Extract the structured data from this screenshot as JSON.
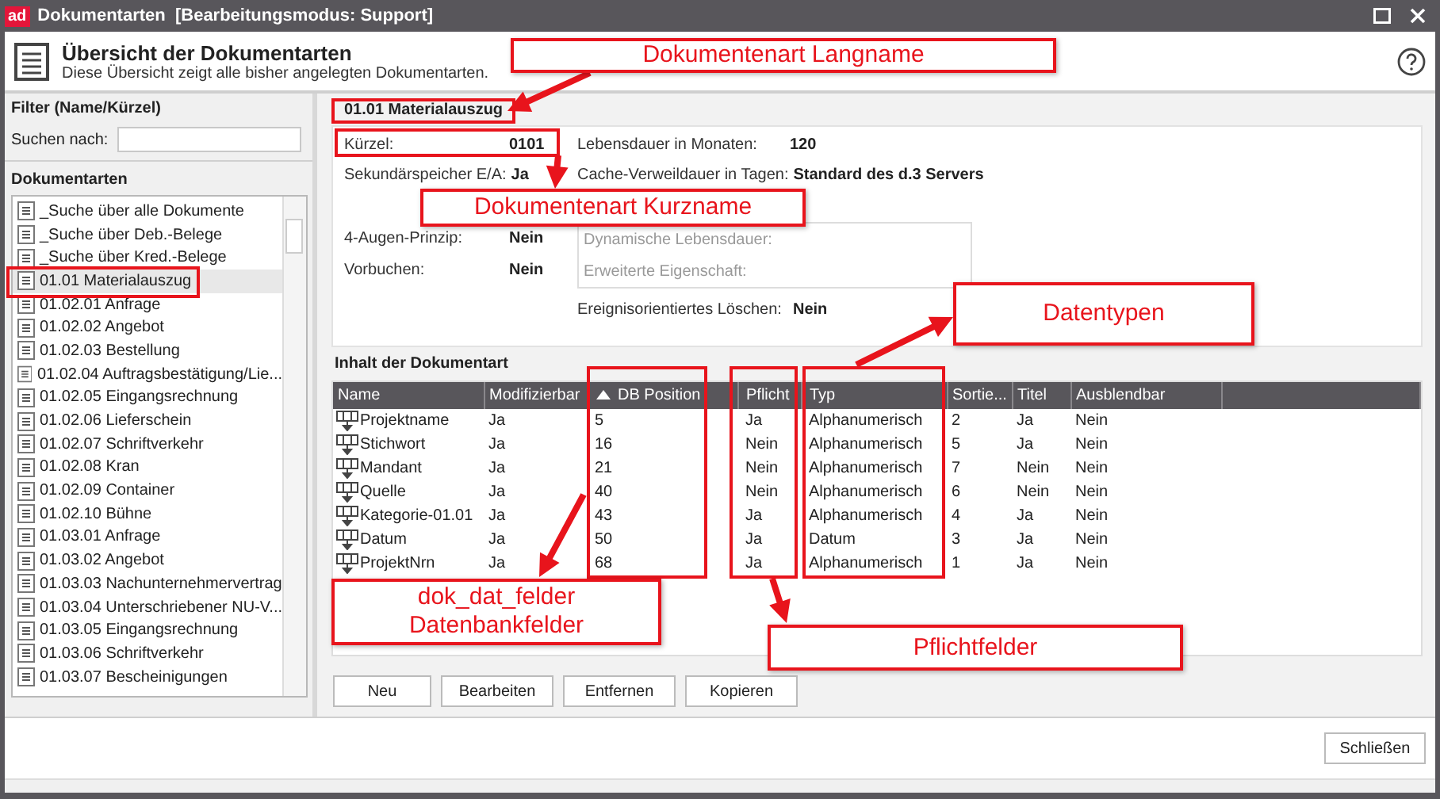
{
  "window": {
    "badge": "ad",
    "title": "Dokumentarten",
    "mode": "[Bearbeitungsmodus: Support]"
  },
  "header": {
    "title": "Übersicht der Dokumentarten",
    "subtitle": "Diese Übersicht zeigt alle bisher angelegten Dokumentarten."
  },
  "filter": {
    "heading": "Filter (Name/Kürzel)",
    "label": "Suchen nach:"
  },
  "document_types": {
    "heading": "Dokumentarten",
    "items": [
      {
        "label": "_Suche über alle Dokumente",
        "selected": false
      },
      {
        "label": "_Suche über Deb.-Belege",
        "selected": false
      },
      {
        "label": "_Suche über Kred.-Belege",
        "selected": false
      },
      {
        "label": "01.01 Materialauszug",
        "selected": true
      },
      {
        "label": "01.02.01 Anfrage",
        "selected": false
      },
      {
        "label": "01.02.02 Angebot",
        "selected": false
      },
      {
        "label": "01.02.03 Bestellung",
        "selected": false
      },
      {
        "label": "01.02.04 Auftragsbestätigung/Lie...",
        "selected": false
      },
      {
        "label": "01.02.05 Eingangsrechnung",
        "selected": false
      },
      {
        "label": "01.02.06 Lieferschein",
        "selected": false
      },
      {
        "label": "01.02.07 Schriftverkehr",
        "selected": false
      },
      {
        "label": "01.02.08 Kran",
        "selected": false
      },
      {
        "label": "01.02.09 Container",
        "selected": false
      },
      {
        "label": "01.02.10 Bühne",
        "selected": false
      },
      {
        "label": "01.03.01 Anfrage",
        "selected": false
      },
      {
        "label": "01.03.02 Angebot",
        "selected": false
      },
      {
        "label": "01.03.03 Nachunternehmervertrag",
        "selected": false
      },
      {
        "label": "01.03.04 Unterschriebener NU-V...",
        "selected": false
      },
      {
        "label": "01.03.05 Eingangsrechnung",
        "selected": false
      },
      {
        "label": "01.03.06 Schriftverkehr",
        "selected": false
      },
      {
        "label": "01.03.07 Bescheinigungen",
        "selected": false
      }
    ]
  },
  "detail": {
    "title": "01.01 Materialauszug",
    "fields_left": [
      {
        "label": "Kürzel:",
        "value": "0101"
      },
      {
        "label": "Sekundärspeicher E/A:",
        "value": "Ja"
      },
      {
        "label": "4-Augen-Prinzip:",
        "value": "Nein"
      },
      {
        "label": "Vorbuchen:",
        "value": "Nein"
      }
    ],
    "fields_right": [
      {
        "label": "Lebensdauer in Monaten:",
        "value": "120"
      },
      {
        "label": "Cache-Verweildauer in Tagen:",
        "value": "Standard des d.3 Servers"
      }
    ],
    "extra_box": [
      "Dynamische Lebensdauer:",
      "Erweiterte Eigenschaft:"
    ],
    "event_delete": {
      "label": "Ereignisorientiertes Löschen:",
      "value": "Nein"
    }
  },
  "content": {
    "heading": "Inhalt der Dokumentart",
    "columns": [
      {
        "label": "Name",
        "sorted": false
      },
      {
        "label": "Modifizierbar",
        "sorted": false
      },
      {
        "label": "DB Position",
        "sorted": true
      },
      {
        "label": "Pflicht",
        "sorted": false
      },
      {
        "label": "Typ",
        "sorted": false
      },
      {
        "label": "Sortie...",
        "sorted": false
      },
      {
        "label": "Titel",
        "sorted": false
      },
      {
        "label": "Ausblendbar",
        "sorted": false
      }
    ],
    "rows": [
      [
        "Projektname",
        "Ja",
        "5",
        "Ja",
        "Alphanumerisch",
        "2",
        "Ja",
        "Nein"
      ],
      [
        "Stichwort",
        "Ja",
        "16",
        "Nein",
        "Alphanumerisch",
        "5",
        "Ja",
        "Nein"
      ],
      [
        "Mandant",
        "Ja",
        "21",
        "Nein",
        "Alphanumerisch",
        "7",
        "Nein",
        "Nein"
      ],
      [
        "Quelle",
        "Ja",
        "40",
        "Nein",
        "Alphanumerisch",
        "6",
        "Nein",
        "Nein"
      ],
      [
        "Kategorie-01.01",
        "Ja",
        "43",
        "Ja",
        "Alphanumerisch",
        "4",
        "Ja",
        "Nein"
      ],
      [
        "Datum",
        "Ja",
        "50",
        "Ja",
        "Datum",
        "3",
        "Ja",
        "Nein"
      ],
      [
        "ProjektNrn",
        "Ja",
        "68",
        "Ja",
        "Alphanumerisch",
        "1",
        "Ja",
        "Nein"
      ]
    ]
  },
  "actions": [
    "Neu",
    "Bearbeiten",
    "Entfernen",
    "Kopieren"
  ],
  "close_button": "Schließen",
  "annotations": [
    "Dokumentenart Langname",
    "Dokumentenart Kurzname",
    "Datentypen",
    "dok_dat_felder\nDatenbankfelder",
    "Pflichtfelder"
  ]
}
